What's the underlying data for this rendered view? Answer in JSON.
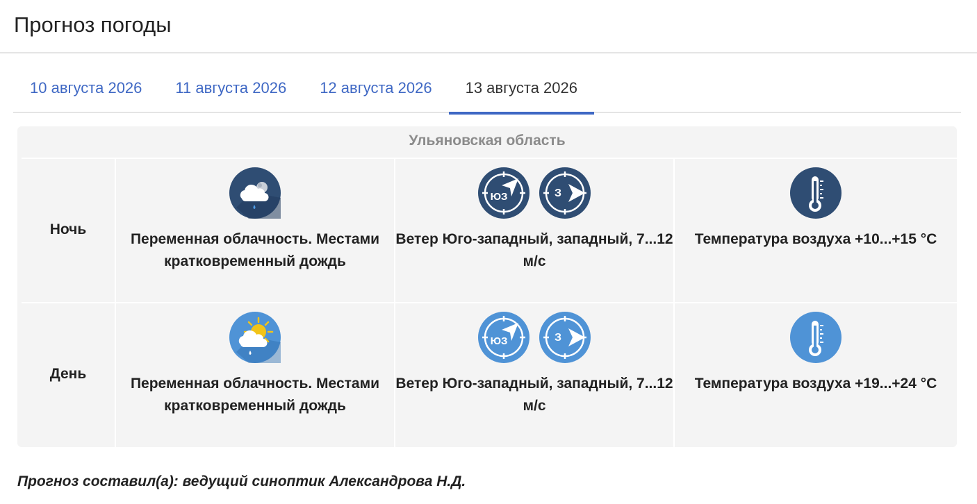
{
  "page_title": "Прогноз погоды",
  "tabs": [
    {
      "label": "10 августа 2026",
      "active": false
    },
    {
      "label": "11 августа 2026",
      "active": false
    },
    {
      "label": "12 августа 2026",
      "active": false
    },
    {
      "label": "13 августа 2026",
      "active": true
    }
  ],
  "region": "Ульяновская область",
  "periods": [
    {
      "label": "Ночь",
      "cloud": {
        "icon": "cloud-moon-rain-icon",
        "text": "Переменная облачность. Местами кратковременный дождь"
      },
      "wind": {
        "icons": [
          {
            "name": "wind-southwest-icon",
            "dir": "ЮЗ"
          },
          {
            "name": "wind-west-icon",
            "dir": "З"
          }
        ],
        "text": "Ветер Юго-западный, западный, 7...12 м/с"
      },
      "temp": {
        "icon": "thermometer-icon",
        "text": "Температура воздуха +10...+15 °C"
      },
      "icon_color": "#2f4d73"
    },
    {
      "label": "День",
      "cloud": {
        "icon": "cloud-sun-rain-icon",
        "text": "Переменная облачность. Местами кратковременный дождь"
      },
      "wind": {
        "icons": [
          {
            "name": "wind-southwest-icon",
            "dir": "ЮЗ"
          },
          {
            "name": "wind-west-icon",
            "dir": "З"
          }
        ],
        "text": "Ветер Юго-западный, западный, 7...12 м/с"
      },
      "temp": {
        "icon": "thermometer-icon",
        "text": "Температура воздуха +19...+24 °C"
      },
      "icon_color": "#4f93d6"
    }
  ],
  "author": "Прогноз составил(а): ведущий синоптик Александрова Н.Д.",
  "colors": {
    "accent": "#3f68c4",
    "night_icon": "#2f4d73",
    "day_icon": "#4f93d6",
    "sun": "#f2c418"
  }
}
